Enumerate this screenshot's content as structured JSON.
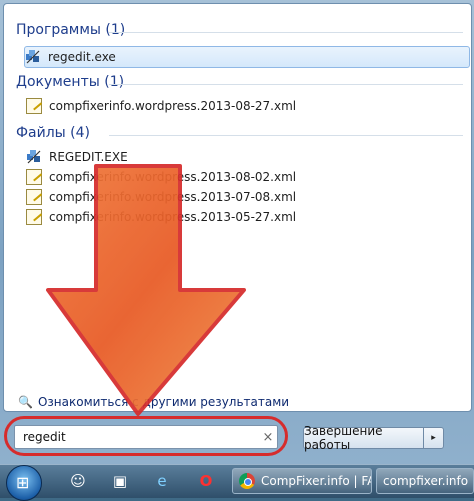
{
  "groups": {
    "programs": {
      "header": "Программы (1)",
      "items": [
        "regedit.exe"
      ]
    },
    "documents": {
      "header": "Документы (1)",
      "items": [
        "compfixerinfo.wordpress.2013-08-27.xml"
      ]
    },
    "files": {
      "header": "Файлы (4)",
      "items": [
        "REGEDIT.EXE",
        "compfixerinfo.wordpress.2013-08-02.xml",
        "compfixerinfo.wordpress.2013-07-08.xml",
        "compfixerinfo.wordpress.2013-05-27.xml"
      ]
    }
  },
  "see_more": "Ознакомиться с другими результатами",
  "search": {
    "value": "regedit",
    "clear_glyph": "×"
  },
  "shutdown": {
    "label": "Завершение работы",
    "arrow_glyph": "▸"
  },
  "taskbar": {
    "chrome_window_label": "CompFixer.info | FA...",
    "right_window_label": "compfixer.info"
  },
  "annotation": {
    "arrow_color": "#ec5b2a",
    "ring_color": "#d62c2c"
  }
}
